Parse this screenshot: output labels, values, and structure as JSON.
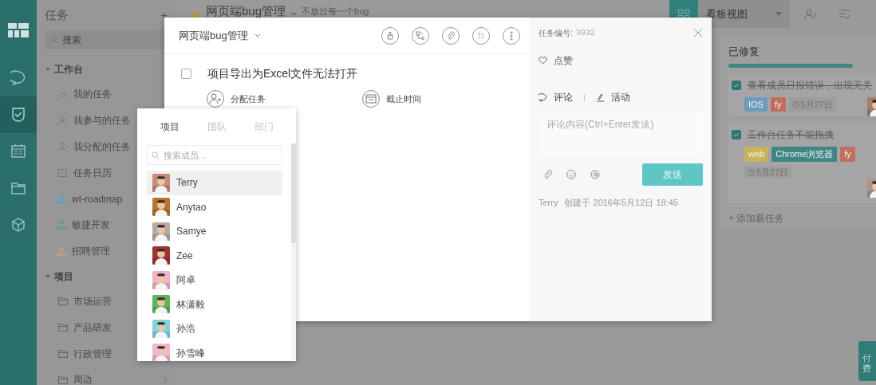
{
  "rail": [
    {
      "kind": "chat",
      "selected": false
    },
    {
      "kind": "task",
      "selected": true
    },
    {
      "kind": "calendar",
      "selected": false
    },
    {
      "kind": "folder",
      "selected": false
    },
    {
      "kind": "cube",
      "selected": false
    }
  ],
  "sidebar": {
    "title": "任务",
    "add": "+",
    "search": {
      "placeholder": "搜索"
    },
    "groups": [
      {
        "label": "工作台",
        "expanded": true,
        "items": [
          {
            "label": "我的任务",
            "kind": "gauge"
          },
          {
            "label": "我参与的任务",
            "kind": "person"
          },
          {
            "label": "我分配的任务",
            "kind": "assign"
          },
          {
            "label": "任务日历",
            "kind": "calendar"
          },
          {
            "label": "wt-roadmap",
            "kind": "team",
            "color": "#6b9db8"
          },
          {
            "label": "敏捷开发",
            "kind": "team",
            "color": "#6f9c86"
          },
          {
            "label": "招聘管理",
            "kind": "team",
            "color": "#b79f7c"
          }
        ]
      },
      {
        "label": "项目",
        "expanded": true,
        "items": [
          {
            "label": "市场运营",
            "kind": "folder"
          },
          {
            "label": "产品研发",
            "kind": "folder"
          },
          {
            "label": "行政管理",
            "kind": "folder"
          },
          {
            "label": "周边",
            "kind": "folder",
            "has_children": true
          }
        ]
      }
    ]
  },
  "header": {
    "project": "网页端bug管理",
    "subtitle": "不放过每一个bug",
    "view": "看板视图"
  },
  "board": {
    "column": {
      "title": "已修复",
      "cards": [
        {
          "title": "查看成员日报错误，出现无关",
          "done": true,
          "tags": [
            {
              "label": "IOS",
              "color": "#6c9bbd"
            },
            {
              "label": "fy",
              "color": "#c06f5c"
            }
          ],
          "due": "5月27日"
        },
        {
          "title": "工作台任务不能拖拽",
          "done": true,
          "tags": [
            {
              "label": "web",
              "color": "#c8b25c"
            },
            {
              "label": "Chrome浏览器",
              "color": "#3e8683"
            },
            {
              "label": "fy",
              "color": "#c06f5c"
            }
          ],
          "due": "5月27日"
        }
      ],
      "add": "+ 添加新任务"
    }
  },
  "pay_button": "付费",
  "modal": {
    "project": "网页端bug管理",
    "task": {
      "title": "项目导出为Excel文件无法打开",
      "done": false
    },
    "actions": [
      {
        "label": "分配任务",
        "kind": "assign"
      },
      {
        "label": "截止时间",
        "kind": "due"
      }
    ],
    "task_number_label": "任务编号:",
    "task_number": "3032",
    "like": "点赞",
    "tabs": [
      {
        "label": "评论",
        "kind": "comment"
      },
      {
        "label": "活动",
        "kind": "activity"
      }
    ],
    "comment": {
      "placeholder": "评论内容(Ctrl+Enter发送)"
    },
    "send": "发送",
    "creator": "Terry",
    "created": "创建于 2016年5月12日 18:45"
  },
  "member_picker": {
    "tabs": [
      {
        "label": "项目",
        "selected": true
      },
      {
        "label": "团队",
        "selected": false
      },
      {
        "label": "部门",
        "selected": false
      }
    ],
    "search": {
      "placeholder": "搜索成员..."
    },
    "members": [
      {
        "name": "Terry",
        "selected": true,
        "color": "#c98a78"
      },
      {
        "name": "Anytao",
        "selected": false,
        "color": "#b8732c"
      },
      {
        "name": "Samye",
        "selected": false,
        "color": "#b9aaa2"
      },
      {
        "name": "Zee",
        "selected": false,
        "color": "#a3302c"
      },
      {
        "name": "阿卓",
        "selected": false,
        "color": "#f2b3c8"
      },
      {
        "name": "林潇毅",
        "selected": false,
        "color": "#5fb55a"
      },
      {
        "name": "孙浩",
        "selected": false,
        "color": "#7fd4e0"
      },
      {
        "name": "孙雪峰",
        "selected": false,
        "color": "#f4b6cc"
      }
    ]
  }
}
